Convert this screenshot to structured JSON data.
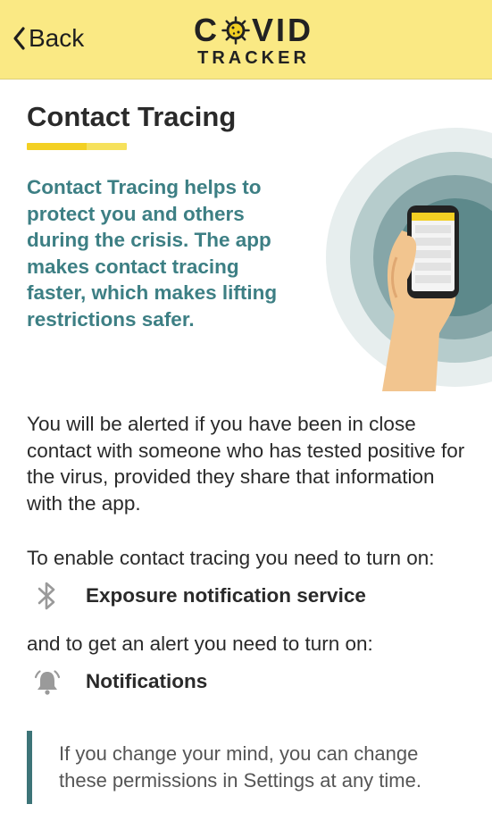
{
  "header": {
    "back_label": "Back",
    "logo_line1": [
      "C",
      "VID"
    ],
    "logo_line2": "TRACKER"
  },
  "page": {
    "title": "Contact Tracing",
    "intro": "Contact Tracing helps to protect you and others during the crisis. The app makes contact tracing faster, which makes lifting restrictions safer.",
    "description": "You will be alerted if you have been in close contact with someone who has tested positive for the virus, provided they share that information with the app.",
    "enable_line": "To enable contact tracing you need to turn on:",
    "permission_1": {
      "label": "Exposure notification service",
      "icon": "bluetooth-icon"
    },
    "alert_line": "and to get an alert you need to turn on:",
    "permission_2": {
      "label": "Notifications",
      "icon": "bell-icon"
    },
    "note": "If you change your mind, you can change these permissions in Settings at any time."
  },
  "colors": {
    "header_bg": "#fae984",
    "accent_yellow": "#f3d023",
    "teal_text": "#3d7f84",
    "note_bar": "#3d7478"
  }
}
